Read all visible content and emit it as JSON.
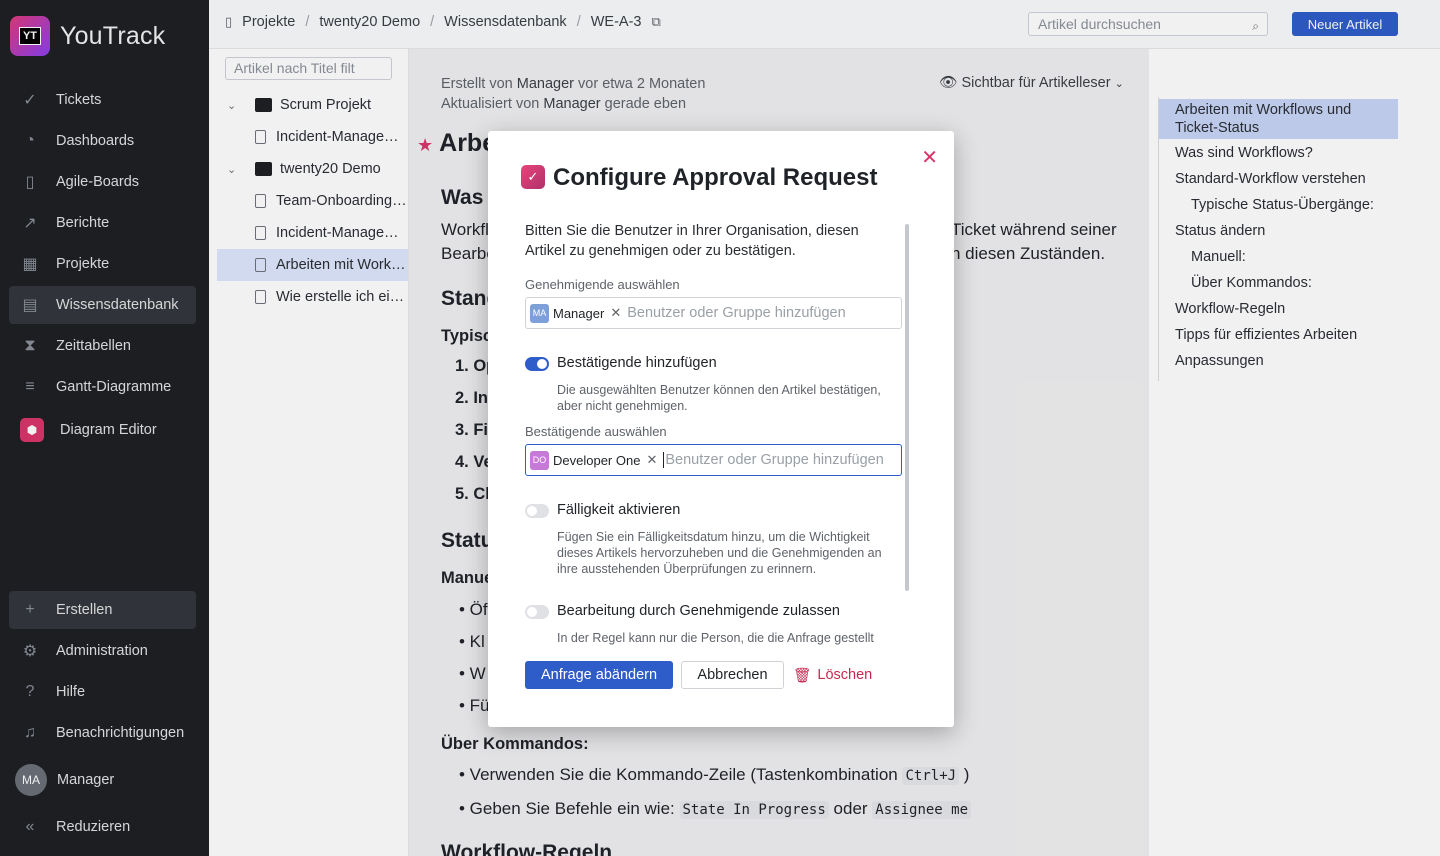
{
  "app": {
    "name": "YouTrack",
    "logo_letters": "YT"
  },
  "sidebar": {
    "items": [
      {
        "label": "Tickets",
        "icon": "check-circle-icon"
      },
      {
        "label": "Dashboards",
        "icon": "dashboard-icon"
      },
      {
        "label": "Agile-Boards",
        "icon": "board-icon"
      },
      {
        "label": "Berichte",
        "icon": "chart-icon"
      },
      {
        "label": "Projekte",
        "icon": "grid-icon"
      },
      {
        "label": "Wissensdatenbank",
        "icon": "book-icon"
      },
      {
        "label": "Zeittabellen",
        "icon": "hourglass-icon"
      },
      {
        "label": "Gantt-Diagramme",
        "icon": "gantt-icon"
      },
      {
        "label": "Diagram Editor",
        "icon": "diagram-icon"
      }
    ],
    "bottom": [
      {
        "label": "Erstellen",
        "icon": "plus-icon"
      },
      {
        "label": "Administration",
        "icon": "gear-icon"
      },
      {
        "label": "Hilfe",
        "icon": "help-icon"
      },
      {
        "label": "Benachrichtigungen",
        "icon": "bell-icon"
      }
    ],
    "user": {
      "initials": "MA",
      "name": "Manager"
    },
    "collapse_label": "Reduzieren"
  },
  "header": {
    "breadcrumbs": [
      "Projekte",
      "twenty20 Demo",
      "Wissensdatenbank",
      "WE-A-3"
    ],
    "search_placeholder": "Artikel durchsuchen",
    "new_article_label": "Neuer Artikel"
  },
  "tree": {
    "filter_placeholder": "Artikel nach Titel filt",
    "rows": [
      {
        "label": "Scrum Projekt",
        "type": "project"
      },
      {
        "label": "Incident-Manage…",
        "type": "doc"
      },
      {
        "label": "twenty20 Demo",
        "type": "project"
      },
      {
        "label": "Team-Onboarding…",
        "type": "doc"
      },
      {
        "label": "Incident-Manage…",
        "type": "doc"
      },
      {
        "label": "Arbeiten mit Work…",
        "type": "doc",
        "selected": true
      },
      {
        "label": "Wie erstelle ich ei…",
        "type": "doc"
      }
    ]
  },
  "article": {
    "created_prefix": "Erstellt von",
    "created_by": "Manager",
    "created_suffix": "vor etwa 2 Monaten",
    "updated_prefix": "Aktualisiert von",
    "updated_by": "Manager",
    "updated_suffix": "gerade eben",
    "visibility": "Sichtbar für Artikelleser",
    "title_fragment": "Arbe",
    "line_was": "Was s",
    "para1_left": "Workfl",
    "para1_right": "Ticket während seiner",
    "para2_left": "Bearbe",
    "para2_right": "n diesen Zuständen.",
    "h_stand": "Stand",
    "h_typisch": "Typisc",
    "list": [
      "1. Op",
      "2. In",
      "3. Fi",
      "4. Ve",
      "5. Cl"
    ],
    "h_status": "Statu",
    "h_manu": "Manue",
    "bullets": [
      "• Öf",
      "• Kl",
      "• W",
      "• Fü"
    ],
    "h_kommandos": "Über Kommandos:",
    "cmd1_text": "• Verwenden Sie die Kommando-Zeile (Tastenkombination",
    "cmd1_code": "Ctrl+J",
    "cmd1_end": ")",
    "cmd2_text": "• Geben Sie Befehle ein wie:",
    "cmd2_code1": "State In Progress",
    "cmd2_mid": "oder",
    "cmd2_code2": "Assignee me",
    "h_workflow": "Workflow-Regeln"
  },
  "toc": {
    "items": [
      {
        "label": "Arbeiten mit Workflows und Ticket-Status",
        "level": 0,
        "active": true
      },
      {
        "label": "Was sind Workflows?",
        "level": 0
      },
      {
        "label": "Standard-Workflow verstehen",
        "level": 0
      },
      {
        "label": "Typische Status-Übergänge:",
        "level": 1
      },
      {
        "label": "Status ändern",
        "level": 0
      },
      {
        "label": "Manuell:",
        "level": 1
      },
      {
        "label": "Über Kommandos:",
        "level": 1
      },
      {
        "label": "Workflow-Regeln",
        "level": 0
      },
      {
        "label": "Tipps für effizientes Arbeiten",
        "level": 0
      },
      {
        "label": "Anpassungen",
        "level": 0
      }
    ]
  },
  "modal": {
    "title": "Configure Approval Request",
    "description": "Bitten Sie die Benutzer in Ihrer Organisation, diesen Artikel zu genehmigen oder zu bestätigen.",
    "approvers_label": "Genehmigende auswählen",
    "approver_chip": {
      "initials": "MA",
      "name": "Manager"
    },
    "approvers_placeholder": "Benutzer oder Gruppe hinzufügen",
    "confirmers_toggle_label": "Bestätigende hinzufügen",
    "confirmers_toggle_on": true,
    "confirmers_desc": "Die ausgewählten Benutzer können den Artikel bestätigen, aber nicht genehmigen.",
    "confirmers_label": "Bestätigende auswählen",
    "confirmer_chip": {
      "initials": "DO",
      "name": "Developer One"
    },
    "confirmers_placeholder": "Benutzer oder Gruppe hinzufügen",
    "due_toggle_label": "Fälligkeit aktivieren",
    "due_toggle_on": false,
    "due_desc": "Fügen Sie ein Fälligkeitsdatum hinzu, um die Wichtigkeit dieses Artikels hervorzuheben und die Genehmigenden an ihre ausstehenden Überprüfungen zu erinnern.",
    "edit_toggle_label": "Bearbeitung durch Genehmigende zulassen",
    "edit_toggle_on": false,
    "edit_desc": "In der Regel kann nur die Person, die die Anfrage gestellt",
    "submit_label": "Anfrage abändern",
    "cancel_label": "Abbrechen",
    "delete_label": "Löschen"
  },
  "colors": {
    "accent": "#2e5cc8",
    "brand": "#d9356a",
    "sidebar_bg": "#1d1f23"
  }
}
